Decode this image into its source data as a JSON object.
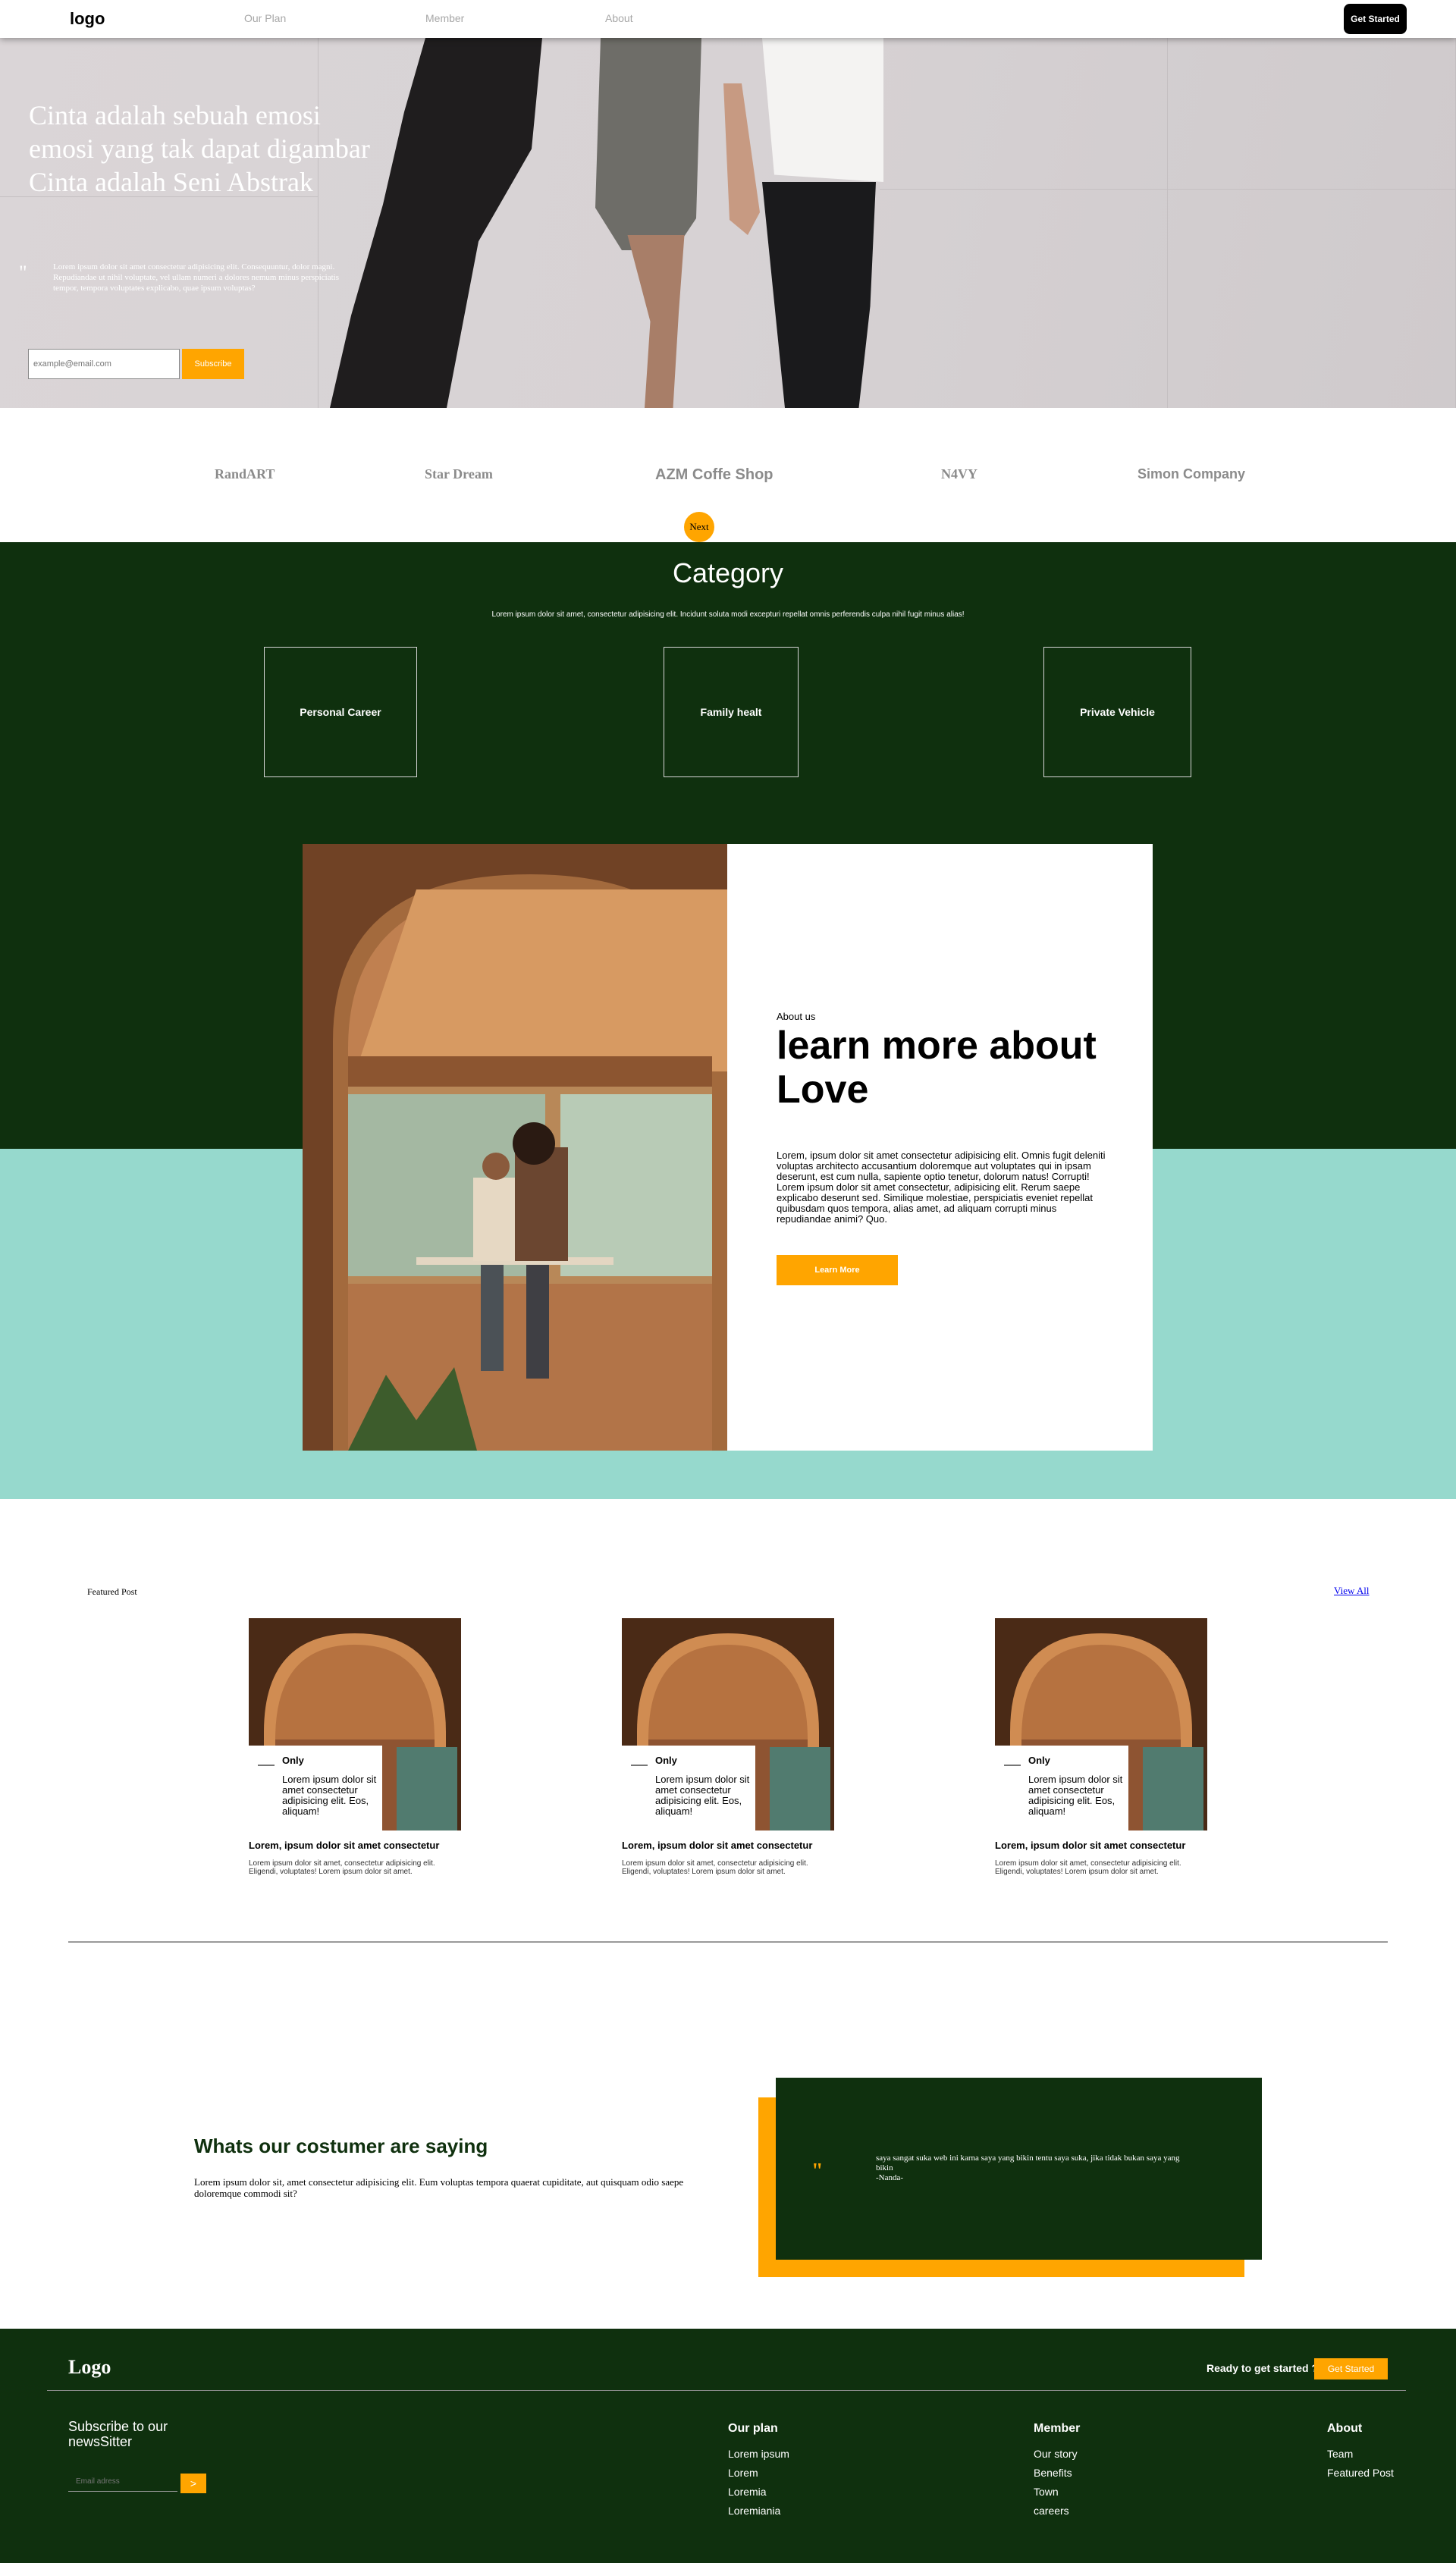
{
  "nav": {
    "logo": "logo",
    "links": [
      "Our Plan",
      "Member",
      "About"
    ],
    "cta": "Get Started"
  },
  "hero": {
    "headline_lines": [
      "Cinta adalah sebuah emosi",
      "emosi yang tak dapat digambar",
      "Cinta adalah Seni Abstrak"
    ],
    "quote_mark": "\"",
    "quote_text": "Lorem ipsum dolor sit amet consectetur adipisicing elit. Consequuntur, dolor magni. Repudiandae ut nihil voluptate, vel ullam numeri a dolores nemum minus perspiciatis tempor, tempora voluptates explicabo, quae ipsum voluptas?",
    "email_placeholder": "example@email.com",
    "subscribe_label": "Subscribe"
  },
  "brands": [
    "RandART",
    "Star Dream",
    "AZM Coffe Shop",
    "N4VY",
    "Simon Company"
  ],
  "next_label": "Next",
  "category": {
    "title": "Category",
    "description": "Lorem ipsum dolor sit amet, consectetur adipisicing elit. Incidunt soluta modi excepturi repellat omnis perferendis culpa nihil fugit minus alias!",
    "items": [
      "Personal Career",
      "Family healt",
      "Private Vehicle"
    ]
  },
  "about": {
    "label": "About us",
    "heading": "learn more about Love",
    "body": "Lorem, ipsum dolor sit amet consectetur adipisicing elit. Omnis fugit deleniti voluptas architecto accusantium doloremque aut voluptates qui in ipsam deserunt, est cum nulla, sapiente optio tenetur, dolorum natus! Corrupti! Lorem ipsum dolor sit amet consectetur, adipisicing elit. Rerum saepe explicabo deserunt sed. Similique molestiae, perspiciatis eveniet repellat quibusdam quos tempora, alias amet, ad aliquam corrupti minus repudiandae animi? Quo.",
    "button": "Learn More"
  },
  "featured": {
    "title": "Featured Post",
    "view_all": "View All",
    "posts": [
      {
        "tag": "Only",
        "box_text": "Lorem ipsum dolor sit amet consectetur adipisicing elit. Eos, aliquam!",
        "title": "Lorem, ipsum dolor sit amet consectetur",
        "desc": "Lorem ipsum dolor sit amet, consectetur adipisicing elit. Eligendi, voluptates! Lorem ipsum dolor sit amet."
      },
      {
        "tag": "Only",
        "box_text": "Lorem ipsum dolor sit amet consectetur adipisicing elit. Eos, aliquam!",
        "title": "Lorem, ipsum dolor sit amet consectetur",
        "desc": "Lorem ipsum dolor sit amet, consectetur adipisicing elit. Eligendi, voluptates! Lorem ipsum dolor sit amet."
      },
      {
        "tag": "Only",
        "box_text": "Lorem ipsum dolor sit amet consectetur adipisicing elit. Eos, aliquam!",
        "title": "Lorem, ipsum dolor sit amet consectetur",
        "desc": "Lorem ipsum dolor sit amet, consectetur adipisicing elit. Eligendi, voluptates! Lorem ipsum dolor sit amet."
      }
    ]
  },
  "testimonial": {
    "title": "Whats our costumer are saying",
    "body": "Lorem ipsum dolor sit, amet consectetur adipisicing elit. Eum voluptas tempora quaerat cupiditate, aut quisquam odio saepe doloremque commodi sit?",
    "quote_mark": "\"",
    "quote": "saya sangat suka web ini karna saya yang bikin tentu saya suka, jika tidak bukan saya yang bikin",
    "author": "-Nanda-"
  },
  "footer": {
    "logo": "Logo",
    "ready": "Ready to get started ?",
    "cta": "Get Started",
    "subscribe": "Subscribe to our newsSitter",
    "email_placeholder": "Email adress",
    "go": ">",
    "columns": [
      {
        "title": "Our plan",
        "items": [
          "Lorem ipsum",
          "Lorem",
          "Loremia",
          "Loremiania"
        ]
      },
      {
        "title": "Member",
        "items": [
          "Our story",
          "Benefits",
          "Town",
          "careers"
        ]
      },
      {
        "title": "About",
        "items": [
          "Team",
          "Featured Post"
        ]
      }
    ]
  },
  "colors": {
    "accent": "#ffa500",
    "dark_green": "#0f300e",
    "teal": "#96d9cd"
  }
}
